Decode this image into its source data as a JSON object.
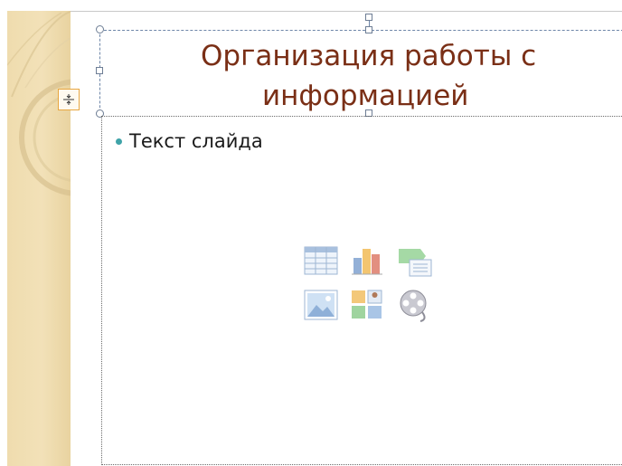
{
  "slide": {
    "title_line1": "Организация работы с",
    "title_line2": "информацией",
    "bullet_text": "Текст слайда"
  },
  "insert_icons": [
    {
      "name": "insert-table-icon"
    },
    {
      "name": "insert-chart-icon"
    },
    {
      "name": "insert-smartart-icon"
    },
    {
      "name": "insert-picture-icon"
    },
    {
      "name": "insert-clipart-icon"
    },
    {
      "name": "insert-media-icon"
    }
  ],
  "colors": {
    "title": "#7a2f16",
    "bullet": "#3fa3a8",
    "left_band": "#efdcae",
    "selection_border": "#6e86a8",
    "autofit_border": "#e8a640"
  }
}
